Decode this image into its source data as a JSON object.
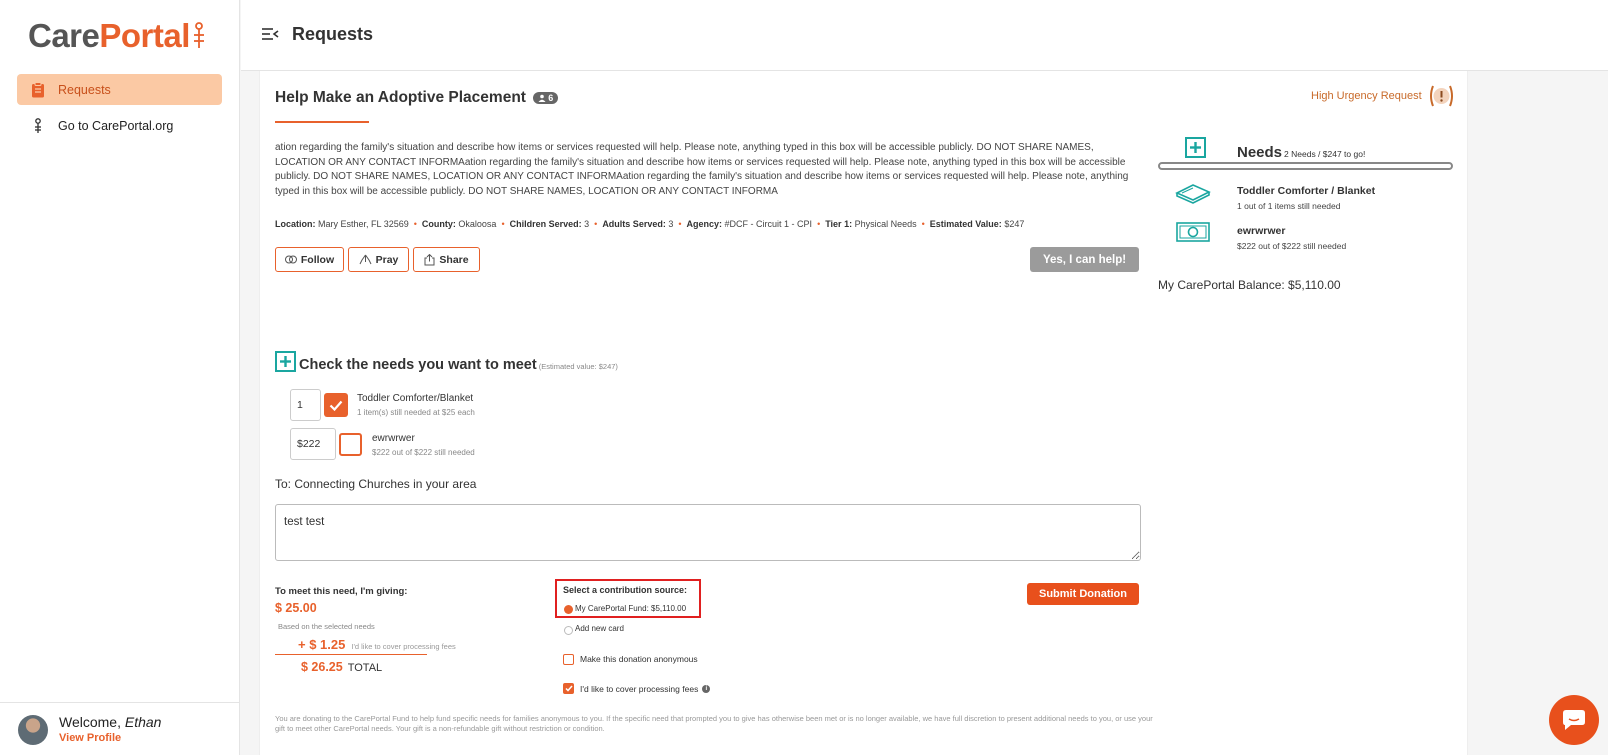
{
  "brand": {
    "logo_part1": "Care",
    "logo_part2": "Portal",
    "accent": "#e8612c"
  },
  "sidebar": {
    "items": [
      {
        "label": "Requests",
        "icon": "clipboard-icon",
        "active": true
      },
      {
        "label": "Go to CarePortal.org",
        "icon": "external-person-icon",
        "active": false
      }
    ],
    "footer": {
      "welcome_prefix": "Welcome,",
      "user_name": "Ethan",
      "view_profile": "View Profile"
    }
  },
  "header": {
    "title": "Requests"
  },
  "request": {
    "title": "Help Make an Adoptive Placement",
    "badge_count": "6",
    "urgency": "High Urgency Request",
    "description": "ation regarding the family's situation and describe how items or services requested will help. Please note, anything typed in this box will be accessible publicly. DO NOT SHARE NAMES, LOCATION OR ANY CONTACT INFORMAation regarding the family's situation and describe how items or services requested will help. Please note, anything typed in this box will be accessible publicly. DO NOT SHARE NAMES, LOCATION OR ANY CONTACT INFORMAation regarding the family's situation and describe how items or services requested will help. Please note, anything typed in this box will be accessible publicly. DO NOT SHARE NAMES, LOCATION OR ANY CONTACT INFORMA",
    "meta": {
      "location_label": "Location:",
      "location": "Mary Esther, FL 32569",
      "county_label": "County:",
      "county": "Okaloosa",
      "children_label": "Children Served:",
      "children": "3",
      "adults_label": "Adults Served:",
      "adults": "3",
      "agency_label": "Agency:",
      "agency": "#DCF - Circuit 1 - CPI",
      "tier_label": "Tier 1:",
      "tier": "Physical Needs",
      "value_label": "Estimated Value:",
      "value": "$247"
    },
    "actions": {
      "follow": "Follow",
      "pray": "Pray",
      "share": "Share",
      "yes": "Yes, I can help!"
    }
  },
  "needs_panel": {
    "title": "Needs",
    "subtitle": "2 Needs / $247 to go!",
    "progress": 0,
    "items": [
      {
        "name": "Toddler Comforter / Blanket",
        "desc": "1 out of 1 items still needed",
        "icon": "blanket-icon"
      },
      {
        "name": "ewrwrwer",
        "desc": "$222 out of $222 still needed",
        "icon": "cash-icon"
      }
    ],
    "balance": "My CarePortal Balance: $5,110.00"
  },
  "check_needs": {
    "title": "Check the needs you want to meet",
    "estimated": "(Estimated value: $247)",
    "items": [
      {
        "qty": "1",
        "name": "Toddler Comforter/Blanket",
        "sub": "1 item(s) still needed at $25 each",
        "checked": true
      },
      {
        "qty": "$222",
        "name": "ewrwrwer",
        "sub": "$222 out of $222 still needed",
        "checked": false
      }
    ]
  },
  "message": {
    "to_line": "To: Connecting Churches in your area",
    "value": "test test"
  },
  "giving": {
    "label": "To meet this need, I'm giving:",
    "amount": "$ 25.00",
    "based_on": "Based on the selected needs",
    "fee_amount": "+ $ 1.25",
    "fee_note": "I'd like to cover processing fees",
    "total_amount": "$ 26.25",
    "total_label": "TOTAL"
  },
  "contribution": {
    "title": "Select a contribution source:",
    "fund_option": "My CarePortal Fund: $5,110.00",
    "new_card_option": "Add new card",
    "anonymous": "Make this donation anonymous",
    "cover_fees": "I'd like to cover processing fees",
    "anonymous_checked": false,
    "cover_fees_checked": true
  },
  "submit": "Submit Donation",
  "disclaimer": "You are donating to the CarePortal Fund to help fund specific needs for families anonymous to you. If the specific need that prompted you to give has otherwise been met or is no longer available, we have full discretion to present additional needs to you, or use your gift to meet other CarePortal needs. Your gift is a non-refundable gift without restriction or condition."
}
